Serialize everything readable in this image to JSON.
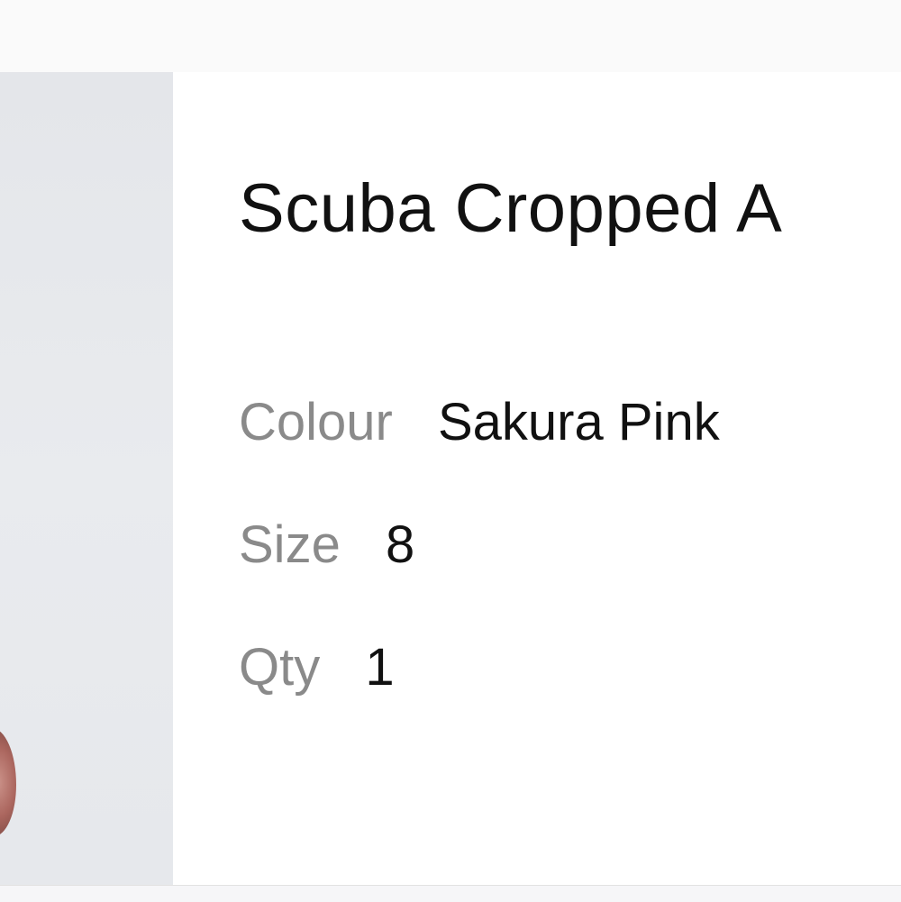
{
  "product": {
    "title": "Scuba Cropped A",
    "image_alt": "product photo",
    "attributes": {
      "colour": {
        "label": "Colour",
        "value": "Sakura Pink"
      },
      "size": {
        "label": "Size",
        "value": "8"
      },
      "qty": {
        "label": "Qty",
        "value": "1"
      }
    }
  },
  "colors": {
    "title_text": "#111111",
    "label_text": "#8a8a8a",
    "image_background": "#e6e8ec"
  }
}
